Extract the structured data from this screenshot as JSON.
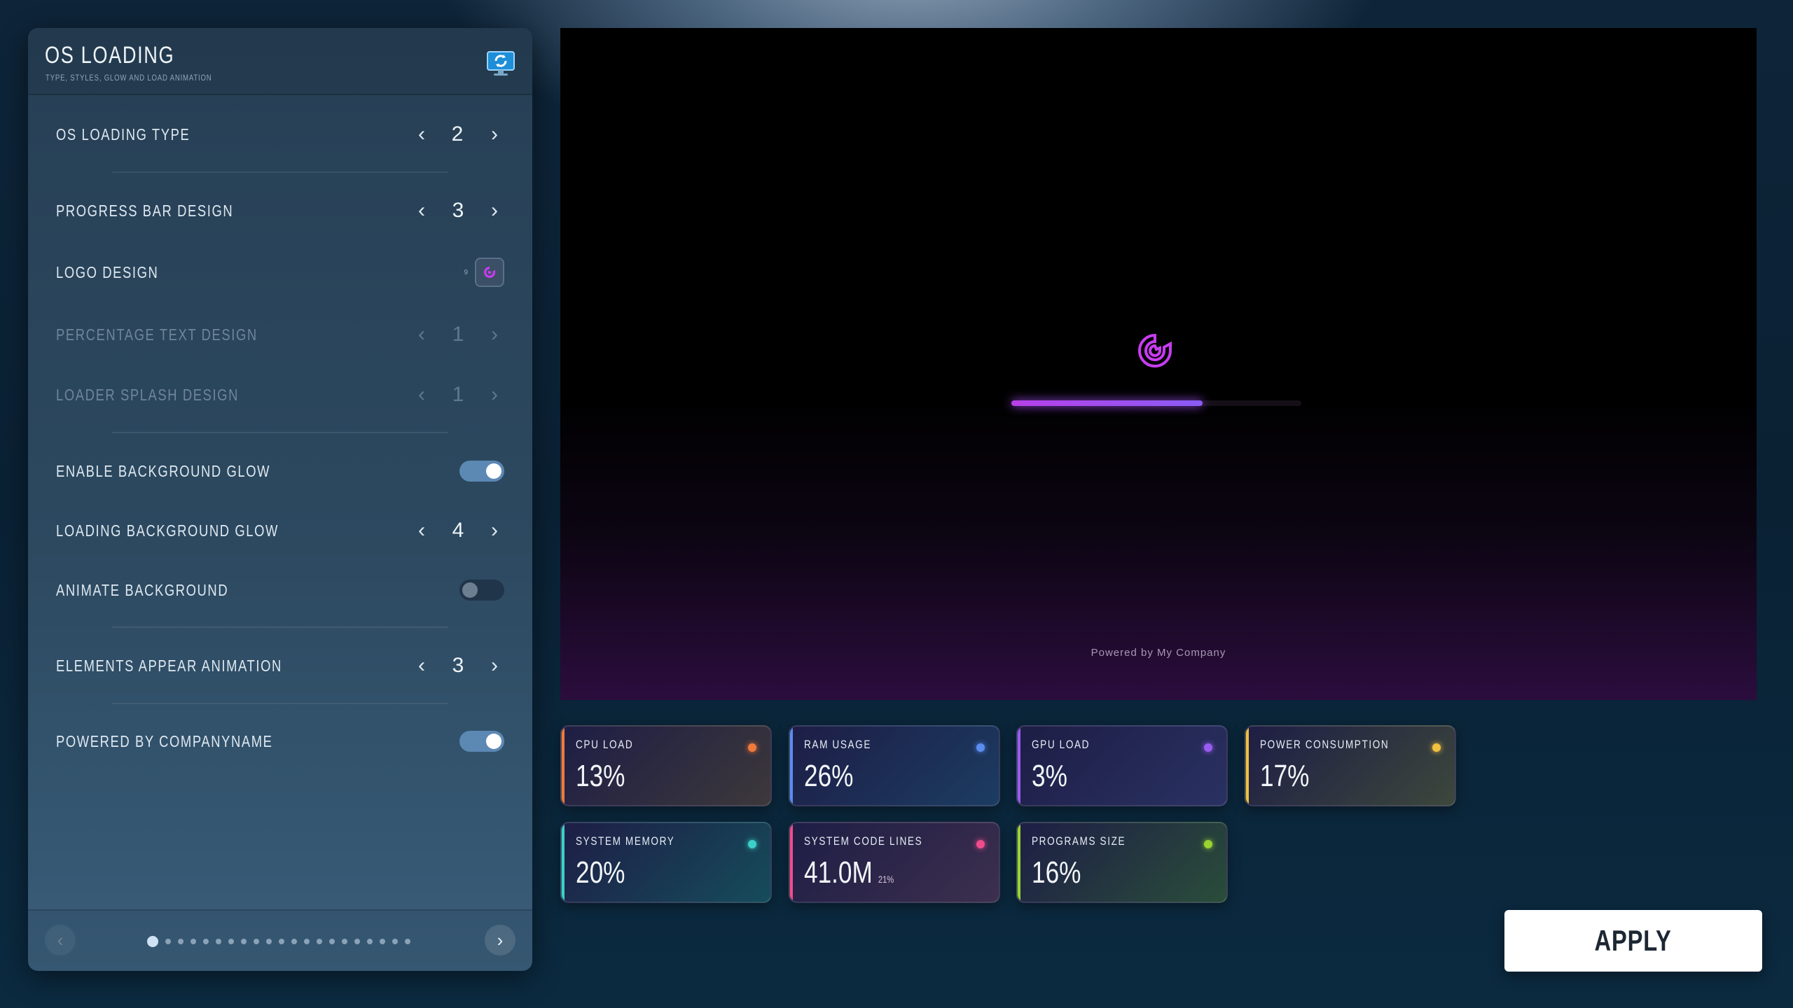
{
  "panel": {
    "title": "OS LOADING",
    "subtitle": "TYPE, STYLES, GLOW AND LOAD ANIMATION",
    "icon": "monitor-refresh-icon",
    "rows": {
      "os_loading_type": {
        "label": "OS LOADING TYPE",
        "value": "2"
      },
      "progress_bar_design": {
        "label": "PROGRESS BAR DESIGN",
        "value": "3"
      },
      "logo_design": {
        "label": "LOGO DESIGN",
        "tiny": "9"
      },
      "percentage_text_design": {
        "label": "PERCENTAGE TEXT DESIGN",
        "value": "1",
        "disabled": true
      },
      "loader_splash_design": {
        "label": "LOADER SPLASH DESIGN",
        "value": "1",
        "disabled": true
      },
      "enable_background_glow": {
        "label": "ENABLE BACKGROUND GLOW",
        "on": true
      },
      "loading_background_glow": {
        "label": "LOADING BACKGROUND GLOW",
        "value": "4"
      },
      "animate_background": {
        "label": "ANIMATE BACKGROUND",
        "on": false
      },
      "elements_appear_animation": {
        "label": "ELEMENTS APPEAR ANIMATION",
        "value": "3"
      },
      "powered_by_companyname": {
        "label": "POWERED BY COMPANYNAME",
        "on": true
      }
    },
    "pagination": {
      "total": 21,
      "current": 1
    }
  },
  "preview": {
    "progress": 0.66,
    "powered_text": "Powered by My Company",
    "colors": {
      "logo": "#c83cf0",
      "bar_start": "#b640e8",
      "bar_end": "#8a5cf6"
    }
  },
  "stats": [
    {
      "label": "CPU LOAD",
      "value": "13%",
      "color": "#f07a3c"
    },
    {
      "label": "RAM USAGE",
      "value": "26%",
      "color": "#5b8cf0"
    },
    {
      "label": "GPU LOAD",
      "value": "3%",
      "color": "#9a5cf0"
    },
    {
      "label": "POWER CONSUMPTION",
      "value": "17%",
      "color": "#f0c040"
    },
    {
      "label": "SYSTEM MEMORY",
      "value": "20%",
      "color": "#3ccfc8"
    },
    {
      "label": "SYSTEM CODE LINES",
      "value": "41.0M",
      "sub": "21%",
      "color": "#f04c8c"
    },
    {
      "label": "PROGRAMS SIZE",
      "value": "16%",
      "color": "#9ad430"
    }
  ],
  "apply_label": "APPLY"
}
